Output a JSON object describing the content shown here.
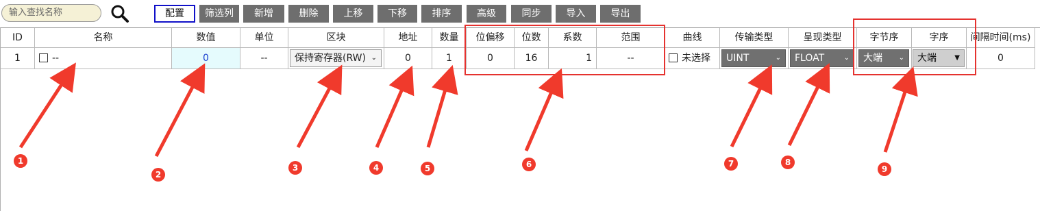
{
  "toolbar": {
    "search_placeholder": "输入查找名称",
    "search_icon": "search-icon",
    "buttons": [
      "配置",
      "筛选列",
      "新增",
      "删除",
      "上移",
      "下移",
      "排序",
      "高级",
      "同步",
      "导入",
      "导出"
    ],
    "active_button": "配置"
  },
  "table": {
    "headers": [
      "ID",
      "名称",
      "数值",
      "单位",
      "区块",
      "地址",
      "数量",
      "位偏移",
      "位数",
      "系数",
      "范围",
      "曲线",
      "传输类型",
      "呈现类型",
      "字节序",
      "字序",
      "间隔时间(ms)"
    ],
    "row": {
      "id": "1",
      "name": "--",
      "value": "0",
      "unit": "--",
      "block": "保持寄存器(RW)",
      "address": "0",
      "count": "1",
      "bit_offset": "0",
      "bits": "16",
      "coefficient": "1",
      "range": "--",
      "curve": "未选择",
      "transfer_type": "UINT",
      "display_type": "FLOAT",
      "byte_order": "大端",
      "word_order": "大端",
      "interval": "0"
    }
  },
  "annotations": [
    "1",
    "2",
    "3",
    "4",
    "5",
    "6",
    "7",
    "8",
    "9"
  ],
  "colors": {
    "highlight": "#e5322f",
    "marker": "#f03a2c",
    "value_cell": "#e5fbfd",
    "active_border": "#1010c8"
  }
}
